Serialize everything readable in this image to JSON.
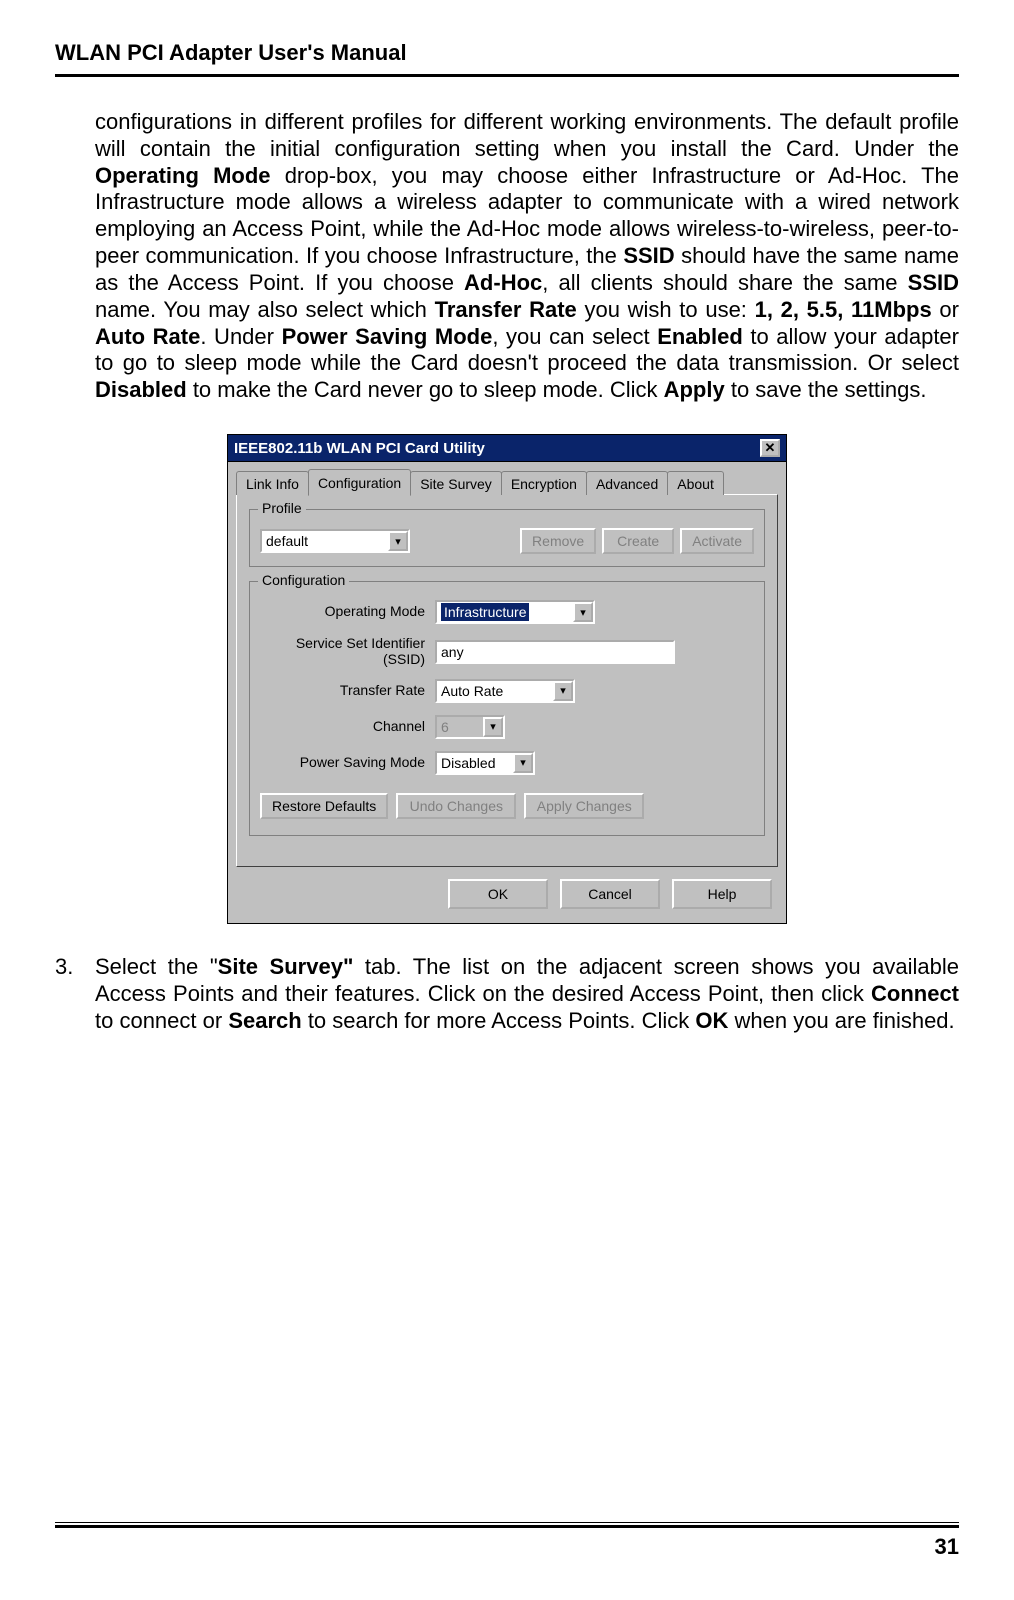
{
  "header": {
    "title": "WLAN PCI Adapter User's Manual"
  },
  "para": {
    "t1": "configurations in different profiles for different working environments. The default profile will contain the initial configuration setting when you install the Card. Under the ",
    "b1": "Operating Mode",
    "t2": " drop-box, you may choose either Infrastructure or Ad-Hoc. The Infrastructure mode allows a wireless adapter to communicate with a wired network employing an Access Point, while the Ad-Hoc mode allows wireless-to-wireless, peer-to-peer communication. If you choose Infrastructure, the ",
    "b2": "SSID",
    "t3": " should have the same name as the Access Point. If you choose ",
    "b3": "Ad-Hoc",
    "t4": ", all clients should share the same ",
    "b4": "SSID",
    "t5": " name. You may also select which ",
    "b5": "Transfer Rate",
    "t6": " you wish to use: ",
    "b6": "1, 2, 5.5, 11Mbps",
    "t7": " or ",
    "b7": "Auto Rate",
    "t8": ". Under ",
    "b8": "Power Saving Mode",
    "t9": ", you can select ",
    "b9": "Enabled",
    "t10": " to allow your adapter to go to sleep mode while the Card doesn't proceed the data transmission. Or select ",
    "b10": "Disabled",
    "t11": " to make the Card never go to sleep mode. Click ",
    "b11": "Apply",
    "t12": " to save the settings."
  },
  "dialog": {
    "title": "IEEE802.11b WLAN PCI Card Utility",
    "tabs": [
      "Link Info",
      "Configuration",
      "Site Survey",
      "Encryption",
      "Advanced",
      "About"
    ],
    "profile": {
      "legend": "Profile",
      "value": "default",
      "remove": "Remove",
      "create": "Create",
      "activate": "Activate"
    },
    "config": {
      "legend": "Configuration",
      "op_mode_label": "Operating Mode",
      "op_mode_value": "Infrastructure",
      "ssid_label_a": "Service Set Identifier",
      "ssid_label_b": "(SSID)",
      "ssid_value": "any",
      "rate_label": "Transfer Rate",
      "rate_value": "Auto Rate",
      "channel_label": "Channel",
      "channel_value": "6",
      "psm_label": "Power Saving Mode",
      "psm_value": "Disabled",
      "restore": "Restore Defaults",
      "undo": "Undo Changes",
      "apply": "Apply Changes"
    },
    "ok": "OK",
    "cancel": "Cancel",
    "help": "Help"
  },
  "step3": {
    "num": "3.",
    "t1": "Select the \"",
    "b1": "Site Survey\"",
    "t2": " tab. The list on the adjacent screen shows you available Access Points and their features. Click on the desired Access Point, then click ",
    "b2": "Connect",
    "t3": " to connect or ",
    "b3": "Search",
    "t4": " to search for more Access Points. Click ",
    "b4": "OK",
    "t5": " when you are finished."
  },
  "page_number": "31"
}
